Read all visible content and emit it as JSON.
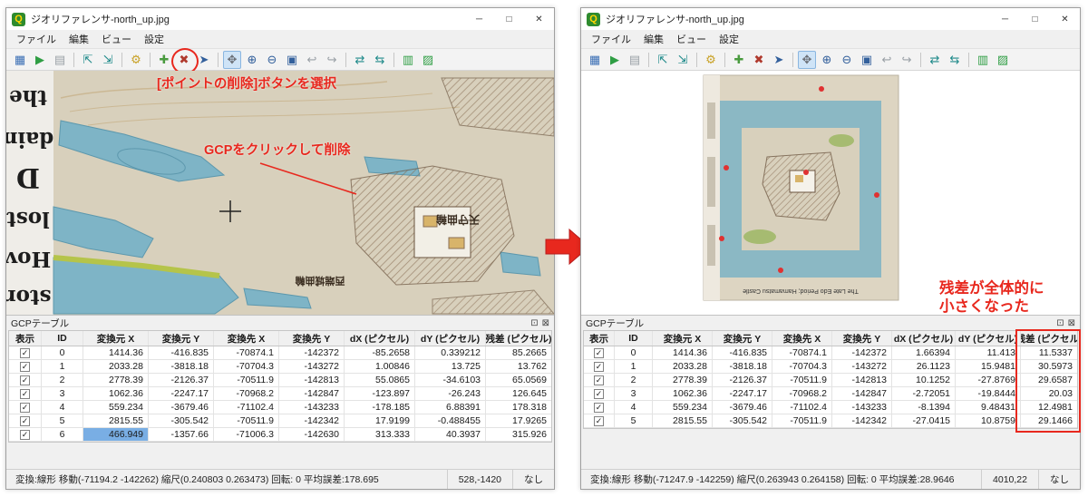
{
  "app_icon_letter": "Q",
  "checkmark": "✓",
  "panel_title": "GCPテーブル",
  "panel_icons": {
    "float": "⊡",
    "close": "⊠"
  },
  "window_controls": {
    "minimize": "─",
    "maximize": "□",
    "close": "✕"
  },
  "menu": [
    {
      "label": "ファイル",
      "name": "menu-file"
    },
    {
      "label": "編集",
      "name": "menu-edit"
    },
    {
      "label": "ビュー",
      "name": "menu-view"
    },
    {
      "label": "設定",
      "name": "menu-settings"
    }
  ],
  "toolbar_icons": [
    {
      "name": "open-raster-icon",
      "glyph": "▦",
      "color": "#3b6fb5"
    },
    {
      "name": "start-georeferencing-icon",
      "glyph": "▶",
      "color": "#2f9e44"
    },
    {
      "name": "generate-script-icon",
      "glyph": "▤",
      "color": "#9aa0a6"
    },
    {
      "name": "separator"
    },
    {
      "name": "load-gcp-points-icon",
      "glyph": "⇱",
      "color": "#1f8a8a"
    },
    {
      "name": "save-gcp-points-icon",
      "glyph": "⇲",
      "color": "#1f8a8a"
    },
    {
      "name": "separator"
    },
    {
      "name": "transformation-settings-icon",
      "glyph": "⚙",
      "color": "#c9a227"
    },
    {
      "name": "separator"
    },
    {
      "name": "add-point-icon",
      "glyph": "✚",
      "color": "#4a9b3f"
    },
    {
      "name": "delete-point-icon",
      "glyph": "✖",
      "color": "#b03a2e"
    },
    {
      "name": "move-point-icon",
      "glyph": "➤",
      "color": "#33609c"
    },
    {
      "name": "separator"
    },
    {
      "name": "pan-icon",
      "glyph": "✥",
      "color": "#6b6f76"
    },
    {
      "name": "zoom-in-icon",
      "glyph": "⊕",
      "color": "#33609c"
    },
    {
      "name": "zoom-out-icon",
      "glyph": "⊖",
      "color": "#33609c"
    },
    {
      "name": "zoom-to-layer-icon",
      "glyph": "▣",
      "color": "#33609c"
    },
    {
      "name": "zoom-last-icon",
      "glyph": "↩",
      "color": "#9aa0a6"
    },
    {
      "name": "zoom-next-icon",
      "glyph": "↪",
      "color": "#9aa0a6"
    },
    {
      "name": "separator"
    },
    {
      "name": "link-georeferencer-to-qgis-icon",
      "glyph": "⇄",
      "color": "#1f8a8a"
    },
    {
      "name": "link-qgis-to-georeferencer-icon",
      "glyph": "⇆",
      "color": "#1f8a8a"
    },
    {
      "name": "separator"
    },
    {
      "name": "full-histogram-stretch-icon",
      "glyph": "▥",
      "color": "#2f9e44"
    },
    {
      "name": "local-histogram-stretch-icon",
      "glyph": "▨",
      "color": "#2f9e44"
    }
  ],
  "gcp_table_headers": [
    "表示",
    "ID",
    "変換元 X",
    "変換元 Y",
    "変換先 X",
    "変換先 Y",
    "dX (ピクセル)",
    "dY (ピクセル)",
    "残差 (ピクセル)"
  ],
  "left_window": {
    "title": "ジオリファレンサ-north_up.jpg",
    "annotations": {
      "toolbar_note": "[ポイントの削除]ボタンを選択",
      "map_note": "GCPをクリックして削除"
    },
    "map_margin_words": [
      "the",
      "dain",
      "D",
      "lost",
      "Hov",
      "stor"
    ],
    "map_labels": [
      "天守曲輪",
      "西端城曲輪"
    ],
    "table": {
      "selected": {
        "row": 6,
        "col": 2
      },
      "rows": [
        [
          "0",
          "1414.36",
          "-416.835",
          "-70874.1",
          "-142372",
          "-85.2658",
          "0.339212",
          "85.2665"
        ],
        [
          "1",
          "2033.28",
          "-3818.18",
          "-70704.3",
          "-143272",
          "1.00846",
          "13.725",
          "13.762"
        ],
        [
          "2",
          "2778.39",
          "-2126.37",
          "-70511.9",
          "-142813",
          "55.0865",
          "-34.6103",
          "65.0569"
        ],
        [
          "3",
          "1062.36",
          "-2247.17",
          "-70968.2",
          "-142847",
          "-123.897",
          "-26.243",
          "126.645"
        ],
        [
          "4",
          "559.234",
          "-3679.46",
          "-71102.4",
          "-143233",
          "-178.185",
          "6.88391",
          "178.318"
        ],
        [
          "5",
          "2815.55",
          "-305.542",
          "-70511.9",
          "-142342",
          "17.9199",
          "-0.488455",
          "17.9265"
        ],
        [
          "6",
          "466.949",
          "-1357.66",
          "-71006.3",
          "-142630",
          "313.333",
          "40.3937",
          "315.926"
        ]
      ]
    },
    "status": {
      "transform": "変換:線形 移動(-71194.2 -142262) 縮尺(0.240803 0.263473) 回転: 0 平均誤差:178.695",
      "coords": "528,-1420",
      "snap": "なし"
    }
  },
  "right_window": {
    "title": "ジオリファレンサ-north_up.jpg",
    "annotations": {
      "residual_note_line1": "残差が全体的に",
      "residual_note_line2": "小さくなった"
    },
    "map_caption": "The Late Edo Period; Hamamatsu Castle",
    "table": {
      "rows": [
        [
          "0",
          "1414.36",
          "-416.835",
          "-70874.1",
          "-142372",
          "1.66394",
          "11.413",
          "11.5337"
        ],
        [
          "1",
          "2033.28",
          "-3818.18",
          "-70704.3",
          "-143272",
          "26.1123",
          "15.9481",
          "30.5973"
        ],
        [
          "2",
          "2778.39",
          "-2126.37",
          "-70511.9",
          "-142813",
          "10.1252",
          "-27.8769",
          "29.6587"
        ],
        [
          "3",
          "1062.36",
          "-2247.17",
          "-70968.2",
          "-142847",
          "-2.72051",
          "-19.8444",
          "20.03"
        ],
        [
          "4",
          "559.234",
          "-3679.46",
          "-71102.4",
          "-143233",
          "-8.1394",
          "9.48431",
          "12.4981"
        ],
        [
          "5",
          "2815.55",
          "-305.542",
          "-70511.9",
          "-142342",
          "-27.0415",
          "10.8759",
          "29.1466"
        ]
      ]
    },
    "status": {
      "transform": "変換:線形 移動(-71247.9 -142259) 縮尺(0.263943 0.264158) 回転: 0 平均誤差:28.9646",
      "coords": "4010,22",
      "snap": "なし"
    }
  },
  "colors": {
    "annotation_red": "#e8281e",
    "water_blue": "#7eb4c6",
    "paper_beige": "#d8d0bc",
    "selection_blue": "#79aee4"
  }
}
